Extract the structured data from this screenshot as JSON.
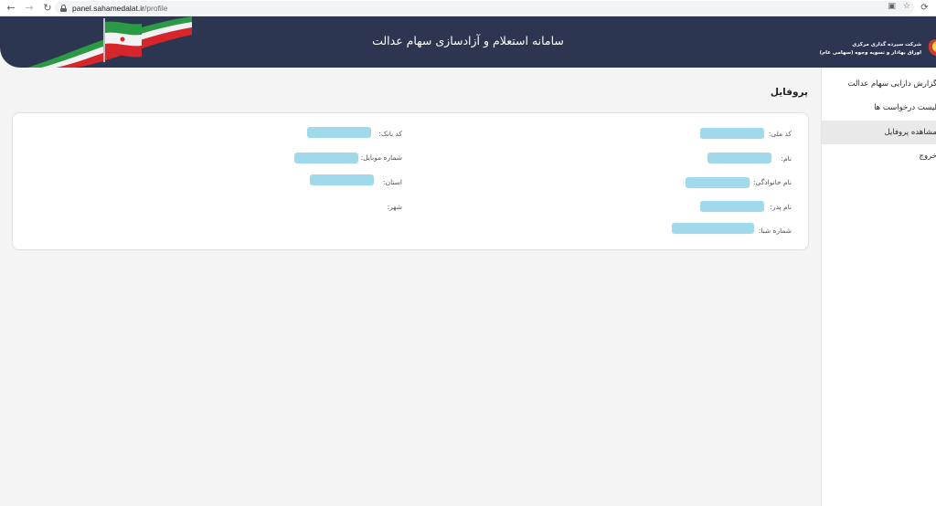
{
  "browser": {
    "url_host": "panel.sahamedalat.ir",
    "url_path": "/profile"
  },
  "header": {
    "title": "سامانه استعلام و آزادسازی سهام عدالت",
    "logo_line1": "شرکت سپرده گذاری مرکزی",
    "logo_line2": "اوراق بهادار و تسویه وجوه (سهامی عام)"
  },
  "sidebar": {
    "items": [
      {
        "label": "گزارش دارایی سهام عدالت",
        "active": false
      },
      {
        "label": "لیست درخواست ها",
        "active": false
      },
      {
        "label": "مشاهده پروفایل",
        "active": true
      },
      {
        "label": "خروج",
        "active": false
      }
    ]
  },
  "page": {
    "title": "پروفایل"
  },
  "profile": {
    "right_fields": [
      {
        "label": "کد ملی:"
      },
      {
        "label": "نام:"
      },
      {
        "label": "نام خانوادگی:"
      },
      {
        "label": "نام پدر:"
      },
      {
        "label": "شماره شبا:"
      }
    ],
    "left_fields": [
      {
        "label": "کد بانک:"
      },
      {
        "label": "شماره موبایل:"
      },
      {
        "label": "استان:"
      },
      {
        "label": "شهر:"
      }
    ]
  },
  "colors": {
    "header_bg": "#2d3650",
    "redaction": "#9fd9ea",
    "active_item_bg": "#e9e9ea"
  }
}
